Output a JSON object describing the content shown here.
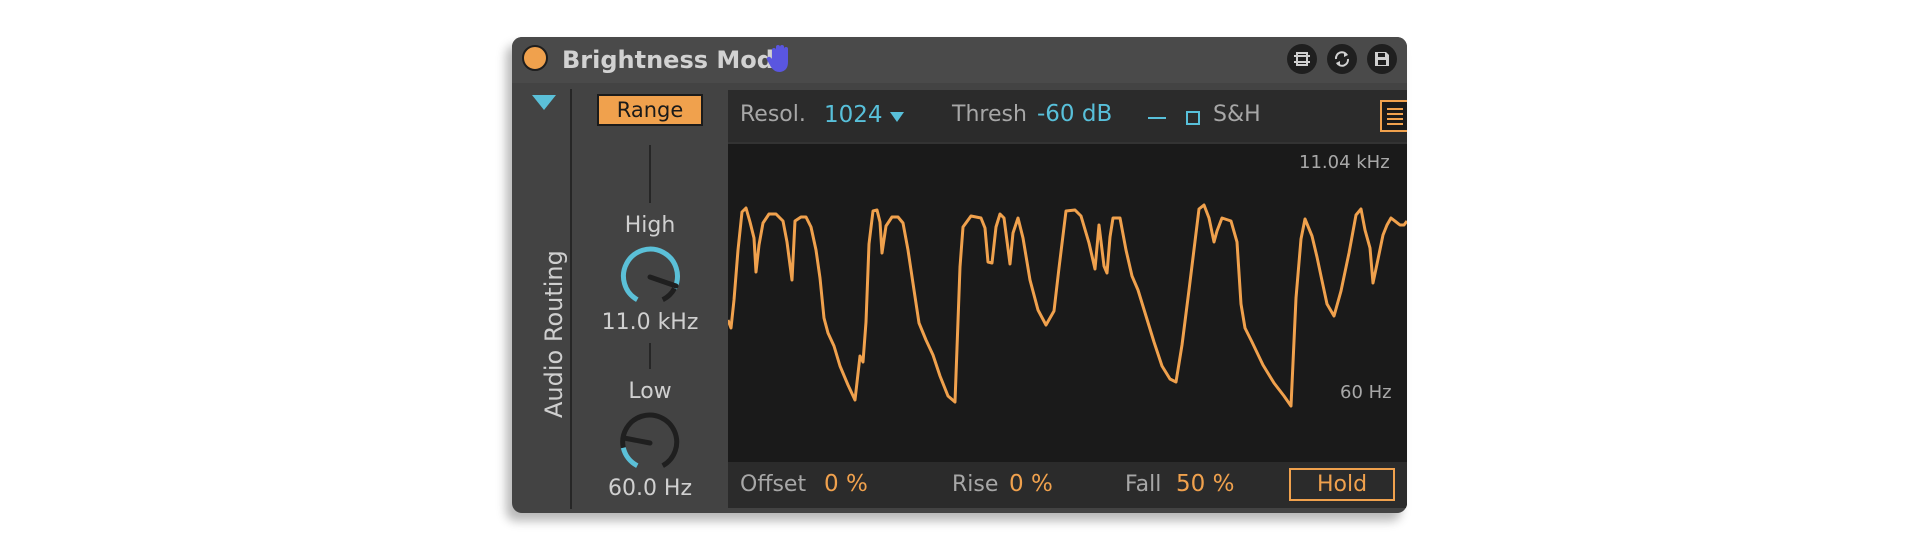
{
  "device": {
    "title": "Brightness Mod",
    "colors": {
      "accent": "#f0a14d",
      "blue": "#58c0da",
      "panel": "#434343",
      "display": "#1a1a1a"
    },
    "icons": [
      "power-button",
      "hand-icon",
      "hot-swap-icon",
      "refresh-icon",
      "save-icon"
    ]
  },
  "sidebar": {
    "routing_label": "Audio Routing"
  },
  "range": {
    "button_label": "Range",
    "high": {
      "label": "High",
      "value": "11.0 kHz"
    },
    "low": {
      "label": "Low",
      "value": "60.0 Hz"
    }
  },
  "toolbar": {
    "resol_label": "Resol.",
    "resol_value": "1024",
    "thresh_label": "Thresh",
    "thresh_value": "-60 dB",
    "sh_label": "S&H"
  },
  "plot": {
    "top_label": "11.04 kHz",
    "bottom_label": "60 Hz",
    "line_color": "#f0a14d"
  },
  "bottom": {
    "offset_label": "Offset",
    "offset_value": "0 %",
    "rise_label": "Rise",
    "rise_value": "0 %",
    "fall_label": "Fall",
    "fall_value": "50 %",
    "hold_label": "Hold"
  }
}
